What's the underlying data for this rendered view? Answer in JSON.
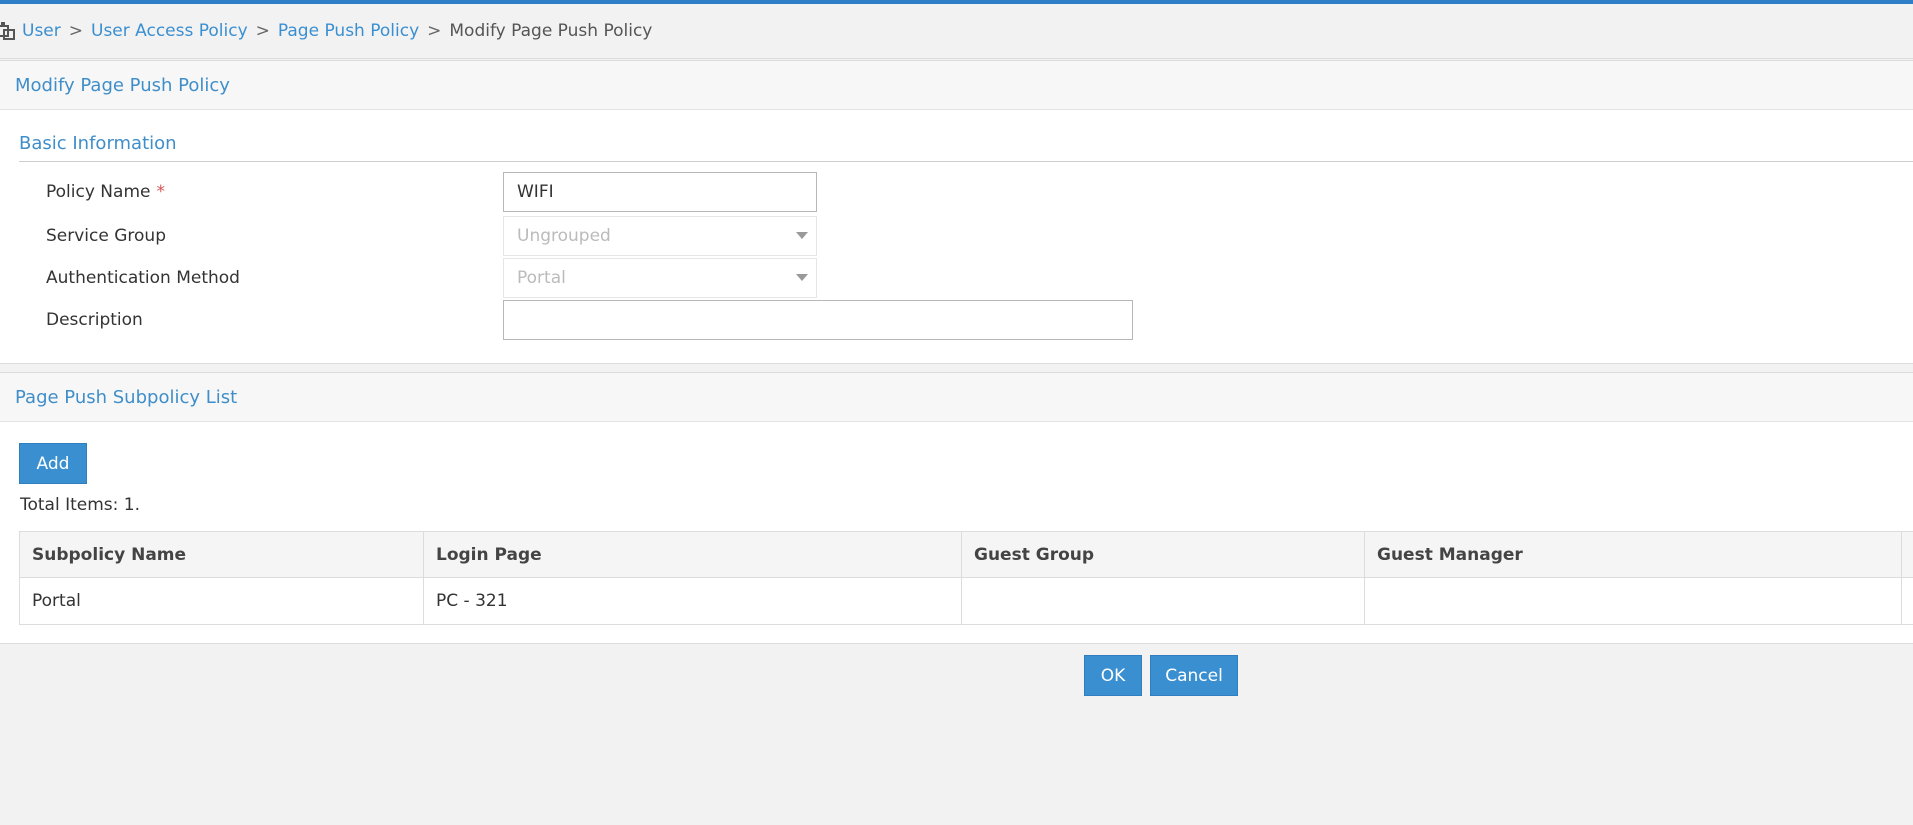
{
  "breadcrumb": {
    "items": [
      "User",
      "User Access Policy",
      "Page Push Policy"
    ],
    "current": "Modify Page Push Policy",
    "separator": ">"
  },
  "page": {
    "title": "Modify Page Push Policy"
  },
  "basic_info": {
    "section_title": "Basic Information",
    "policy_name_label": "Policy Name",
    "policy_name_required": "*",
    "policy_name_value": "WIFI",
    "service_group_label": "Service Group",
    "service_group_value": "Ungrouped",
    "auth_method_label": "Authentication Method",
    "auth_method_value": "Portal",
    "description_label": "Description",
    "description_value": ""
  },
  "subpolicy": {
    "panel_title": "Page Push Subpolicy List",
    "add_label": "Add",
    "total_items": "Total Items: 1.",
    "columns": [
      "Subpolicy Name",
      "Login Page",
      "Guest Group",
      "Guest Manager"
    ],
    "rows": [
      [
        "Portal",
        "PC - 321",
        "",
        ""
      ]
    ]
  },
  "actions": {
    "ok_label": "OK",
    "cancel_label": "Cancel"
  },
  "colors": {
    "accent": "#3a8fd1",
    "required": "#d9534f",
    "top_bar": "#2f7fc8"
  },
  "icons": {
    "breadcrumb_home": "home-icon"
  }
}
